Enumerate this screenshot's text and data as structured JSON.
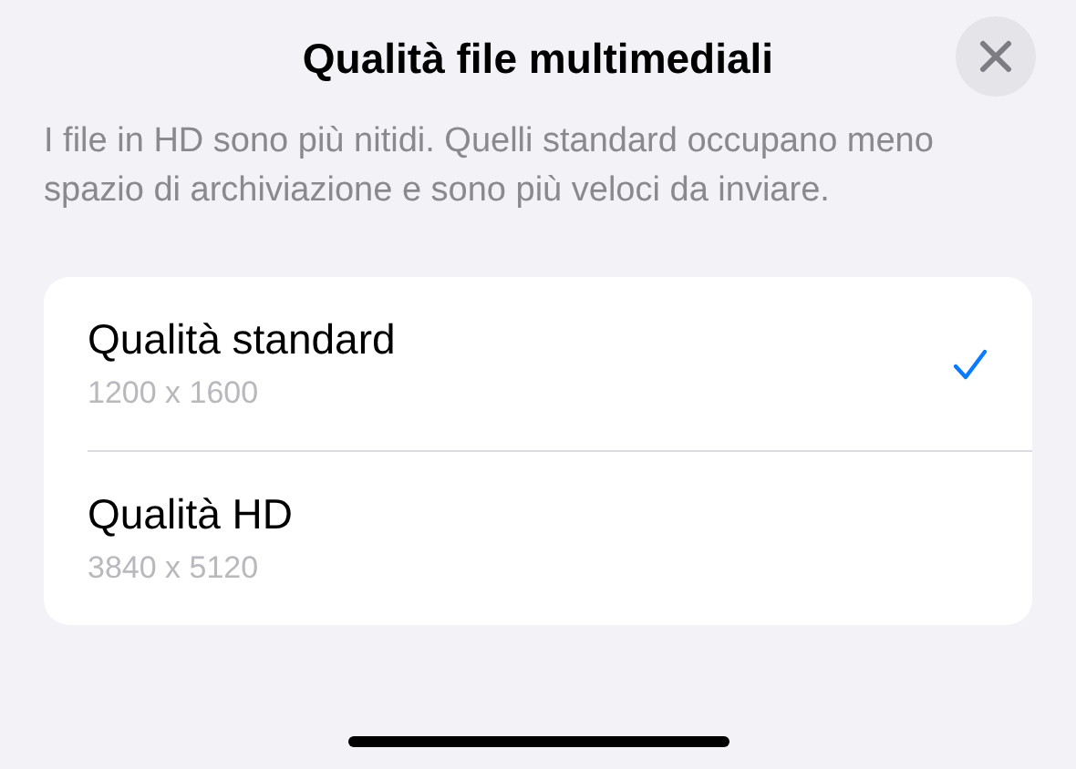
{
  "sheet": {
    "title": "Qualità file multimediali",
    "description": "I file in HD sono più nitidi. Quelli standard occupano meno spazio di archiviazione e sono più veloci da inviare."
  },
  "options": [
    {
      "label": "Qualità standard",
      "detail": "1200 x 1600",
      "selected": true
    },
    {
      "label": "Qualità HD",
      "detail": "3840 x 5120",
      "selected": false
    }
  ]
}
